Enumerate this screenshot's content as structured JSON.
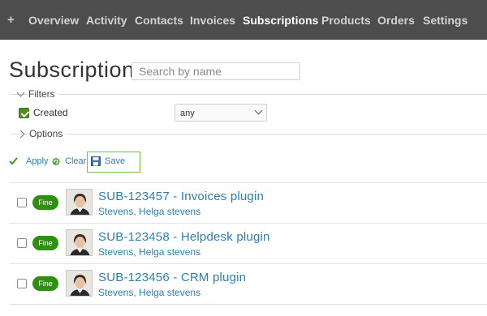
{
  "topnav": {
    "plus": "+",
    "items": [
      "Overview",
      "Activity",
      "Contacts",
      "Invoices",
      "Subscriptions",
      "Products",
      "Orders",
      "Settings"
    ],
    "active": "Subscriptions"
  },
  "header": {
    "title": "Subscriptions",
    "search_placeholder": "Search by name"
  },
  "filters": {
    "label": "Filters",
    "created_label": "Created",
    "created_checked": true,
    "created_value": "any"
  },
  "options": {
    "label": "Options"
  },
  "actions": {
    "apply": "Apply",
    "clear": "Clear",
    "save": "Save"
  },
  "subscriptions": [
    {
      "status": "Fine",
      "title": "SUB-123457 - Invoices plugin",
      "contact": "Stevens, Helga stevens"
    },
    {
      "status": "Fine",
      "title": "SUB-123458 - Helpdesk plugin",
      "contact": "Stevens, Helga stevens"
    },
    {
      "status": "Fine",
      "title": "SUB-123456 - CRM plugin",
      "contact": "Stevens, Helga stevens"
    }
  ],
  "colors": {
    "nav_bg": "#4d4d4d",
    "link": "#2a7fb0",
    "status_fine": "#2f8f10",
    "checkbox": "#4e8f1d",
    "save_outline": "#6fc04a"
  }
}
